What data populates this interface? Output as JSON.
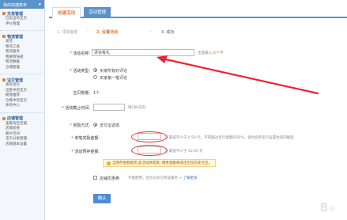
{
  "sidebar": {
    "header": "我的快捷菜单",
    "sections": [
      {
        "title": "交易管理",
        "items": [
          "已卖出的宝贝",
          "评价管理"
        ]
      },
      {
        "title": "物流管理",
        "items": [
          "发货",
          "物流工具",
          "物流服务",
          "我要寄快递",
          "物流数据",
          "仓储管理"
        ]
      },
      {
        "title": "宝贝管理",
        "items": [
          "发布宝贝",
          "出售中的宝贝",
          "橱窗推荐",
          "仓库中的宝贝",
          "体检中心"
        ]
      },
      {
        "title": "店铺管理",
        "items": [
          "查看淘宝店铺",
          "店铺装修",
          "图片空间",
          "宝贝分类管理",
          "店铺基本设置"
        ]
      }
    ]
  },
  "tabs": {
    "create": "创建活动",
    "manage": "活动管理"
  },
  "steps": {
    "s1": "1. 领取面额",
    "s2": "2. 设置活动",
    "s3": "3. 成功"
  },
  "form": {
    "name_label": "活动名称:",
    "name_value": "评论有礼",
    "name_hint_prefix": "还能输入",
    "name_hint_count": "16",
    "name_hint_suffix": "个字",
    "type_label": "活动类型:",
    "type_opt1": "买家所有好评论",
    "type_opt2": "买家第一笔评论",
    "qty_label": "宝贝数量:",
    "qty_value": "1个",
    "deadline_label": "活动截止时间:",
    "deadline_hint": "填180天内",
    "reward_label": "奖励方式:",
    "reward_opt": "支付宝返现",
    "unit_label": "单笔奖励金额:",
    "unit_hint": "元 最低不少于 0.50 元，不得超过宝贝金额的50%，请为您的宝贝设置合适的额度",
    "total_label": "活动预存金额:",
    "total_hint": "元 最低不少于 10.00 元",
    "warning": "当预存金额提完,此活动将结束; 剩余金额将退还至您的支付宝。",
    "shop_label": "店铺优惠券",
    "shop_hint": "不能使用。因为没有订购该服务 >",
    "shop_link": "了解更多",
    "submit": "确认"
  }
}
